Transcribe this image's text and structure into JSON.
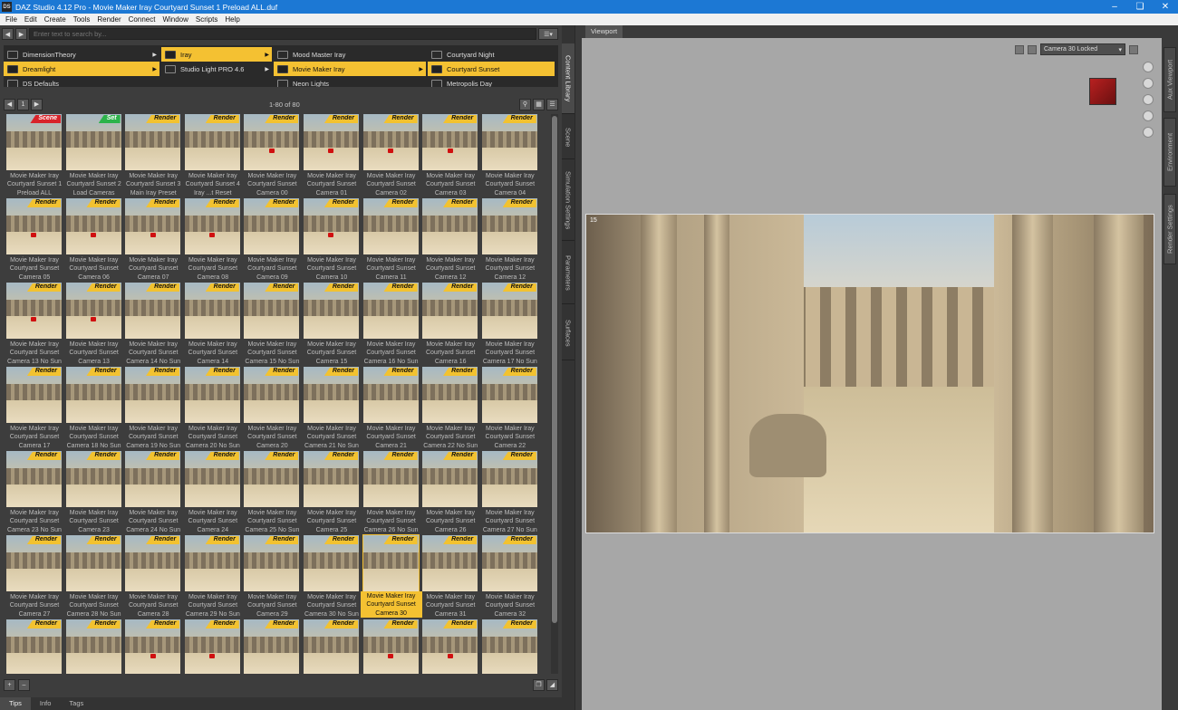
{
  "window": {
    "title": "DAZ Studio 4.12 Pro - Movie Maker Iray Courtyard Sunset 1 Preload ALL.duf",
    "logo": "DS"
  },
  "menu": [
    "File",
    "Edit",
    "Create",
    "Tools",
    "Render",
    "Connect",
    "Window",
    "Scripts",
    "Help"
  ],
  "search": {
    "placeholder": "Enter text to search by..."
  },
  "columns": [
    {
      "items": [
        {
          "label": "DimensionTheory",
          "selected": false,
          "arrow": "▶"
        },
        {
          "label": "Dreamlight",
          "selected": true,
          "arrow": "▶"
        },
        {
          "label": "DS Defaults",
          "selected": false,
          "arrow": ""
        }
      ]
    },
    {
      "items": [
        {
          "label": "Iray",
          "selected": true,
          "arrow": "▶"
        },
        {
          "label": "Studio Light PRO 4.6",
          "selected": false,
          "arrow": "▶"
        }
      ]
    },
    {
      "items": [
        {
          "label": "Mood Master Iray",
          "selected": false,
          "arrow": ""
        },
        {
          "label": "Movie Maker Iray",
          "selected": true,
          "arrow": "▶"
        },
        {
          "label": "Neon Lights",
          "selected": false,
          "arrow": ""
        }
      ]
    },
    {
      "items": [
        {
          "label": "Courtyard Night",
          "selected": false,
          "arrow": ""
        },
        {
          "label": "Courtyard Sunset",
          "selected": true,
          "arrow": ""
        },
        {
          "label": "Metropolis Day",
          "selected": false,
          "arrow": ""
        }
      ]
    }
  ],
  "pager": {
    "page": "1",
    "count": "1-80 of 80"
  },
  "items": [
    {
      "badge": "Scene",
      "kind": "scene",
      "caption": "Movie Maker Iray Courtyard Sunset 1 Preload ALL",
      "dot": false
    },
    {
      "badge": "Set",
      "kind": "set",
      "caption": "Movie Maker Iray Courtyard Sunset 2 Load Cameras",
      "dot": false
    },
    {
      "badge": "Render",
      "kind": "render",
      "caption": "Movie Maker Iray Courtyard Sunset 3 Main Iray Preset",
      "dot": false
    },
    {
      "badge": "Render",
      "kind": "render",
      "caption": "Movie Maker Iray Courtyard Sunset 4 Iray ...t Reset",
      "dot": false
    },
    {
      "badge": "Render",
      "kind": "render",
      "caption": "Movie Maker Iray Courtyard Sunset Camera 00",
      "dot": true
    },
    {
      "badge": "Render",
      "kind": "render",
      "caption": "Movie Maker Iray Courtyard Sunset Camera 01",
      "dot": true
    },
    {
      "badge": "Render",
      "kind": "render",
      "caption": "Movie Maker Iray Courtyard Sunset Camera 02",
      "dot": true
    },
    {
      "badge": "Render",
      "kind": "render",
      "caption": "Movie Maker Iray Courtyard Sunset Camera 03",
      "dot": true
    },
    {
      "badge": "Render",
      "kind": "render",
      "caption": "Movie Maker Iray Courtyard Sunset Camera 04",
      "dot": false
    },
    {
      "badge": "Render",
      "kind": "render",
      "caption": "Movie Maker Iray Courtyard Sunset Camera 05",
      "dot": true
    },
    {
      "badge": "Render",
      "kind": "render",
      "caption": "Movie Maker Iray Courtyard Sunset Camera 06",
      "dot": true
    },
    {
      "badge": "Render",
      "kind": "render",
      "caption": "Movie Maker Iray Courtyard Sunset Camera 07",
      "dot": true
    },
    {
      "badge": "Render",
      "kind": "render",
      "caption": "Movie Maker Iray Courtyard Sunset Camera 08",
      "dot": true
    },
    {
      "badge": "Render",
      "kind": "render",
      "caption": "Movie Maker Iray Courtyard Sunset Camera 09",
      "dot": false
    },
    {
      "badge": "Render",
      "kind": "render",
      "caption": "Movie Maker Iray Courtyard Sunset Camera 10",
      "dot": true
    },
    {
      "badge": "Render",
      "kind": "render",
      "caption": "Movie Maker Iray Courtyard Sunset Camera 11",
      "dot": false
    },
    {
      "badge": "Render",
      "kind": "render",
      "caption": "Movie Maker Iray Courtyard Sunset Camera 12",
      "dot": false
    },
    {
      "badge": "Render",
      "kind": "render",
      "caption": "Movie Maker Iray Courtyard Sunset Camera 12",
      "dot": false
    },
    {
      "badge": "Render",
      "kind": "render",
      "caption": "Movie Maker Iray Courtyard Sunset Camera 13 No Sun",
      "dot": true
    },
    {
      "badge": "Render",
      "kind": "render",
      "caption": "Movie Maker Iray Courtyard Sunset Camera 13",
      "dot": true
    },
    {
      "badge": "Render",
      "kind": "render",
      "caption": "Movie Maker Iray Courtyard Sunset Camera 14 No Sun",
      "dot": false
    },
    {
      "badge": "Render",
      "kind": "render",
      "caption": "Movie Maker Iray Courtyard Sunset Camera 14",
      "dot": false
    },
    {
      "badge": "Render",
      "kind": "render",
      "caption": "Movie Maker Iray Courtyard Sunset Camera 15 No Sun",
      "dot": false
    },
    {
      "badge": "Render",
      "kind": "render",
      "caption": "Movie Maker Iray Courtyard Sunset Camera 15",
      "dot": false
    },
    {
      "badge": "Render",
      "kind": "render",
      "caption": "Movie Maker Iray Courtyard Sunset Camera 16 No Sun",
      "dot": false
    },
    {
      "badge": "Render",
      "kind": "render",
      "caption": "Movie Maker Iray Courtyard Sunset Camera 16",
      "dot": false
    },
    {
      "badge": "Render",
      "kind": "render",
      "caption": "Movie Maker Iray Courtyard Sunset Camera 17 No Sun",
      "dot": false
    },
    {
      "badge": "Render",
      "kind": "render",
      "caption": "Movie Maker Iray Courtyard Sunset Camera 17",
      "dot": false
    },
    {
      "badge": "Render",
      "kind": "render",
      "caption": "Movie Maker Iray Courtyard Sunset Camera 18 No Sun",
      "dot": false
    },
    {
      "badge": "Render",
      "kind": "render",
      "caption": "Movie Maker Iray Courtyard Sunset Camera 19 No Sun",
      "dot": false
    },
    {
      "badge": "Render",
      "kind": "render",
      "caption": "Movie Maker Iray Courtyard Sunset Camera 20 No Sun",
      "dot": false
    },
    {
      "badge": "Render",
      "kind": "render",
      "caption": "Movie Maker Iray Courtyard Sunset Camera 20",
      "dot": false
    },
    {
      "badge": "Render",
      "kind": "render",
      "caption": "Movie Maker Iray Courtyard Sunset Camera 21 No Sun",
      "dot": false
    },
    {
      "badge": "Render",
      "kind": "render",
      "caption": "Movie Maker Iray Courtyard Sunset Camera 21",
      "dot": false
    },
    {
      "badge": "Render",
      "kind": "render",
      "caption": "Movie Maker Iray Courtyard Sunset Camera 22 No Sun",
      "dot": false
    },
    {
      "badge": "Render",
      "kind": "render",
      "caption": "Movie Maker Iray Courtyard Sunset Camera 22",
      "dot": false
    },
    {
      "badge": "Render",
      "kind": "render",
      "caption": "Movie Maker Iray Courtyard Sunset Camera 23 No Sun",
      "dot": false
    },
    {
      "badge": "Render",
      "kind": "render",
      "caption": "Movie Maker Iray Courtyard Sunset Camera 23",
      "dot": false
    },
    {
      "badge": "Render",
      "kind": "render",
      "caption": "Movie Maker Iray Courtyard Sunset Camera 24 No Sun",
      "dot": false
    },
    {
      "badge": "Render",
      "kind": "render",
      "caption": "Movie Maker Iray Courtyard Sunset Camera 24",
      "dot": false
    },
    {
      "badge": "Render",
      "kind": "render",
      "caption": "Movie Maker Iray Courtyard Sunset Camera 25 No Sun",
      "dot": false
    },
    {
      "badge": "Render",
      "kind": "render",
      "caption": "Movie Maker Iray Courtyard Sunset Camera 25",
      "dot": false
    },
    {
      "badge": "Render",
      "kind": "render",
      "caption": "Movie Maker Iray Courtyard Sunset Camera 26 No Sun",
      "dot": false
    },
    {
      "badge": "Render",
      "kind": "render",
      "caption": "Movie Maker Iray Courtyard Sunset Camera 26",
      "dot": false
    },
    {
      "badge": "Render",
      "kind": "render",
      "caption": "Movie Maker Iray Courtyard Sunset Camera 27 No Sun",
      "dot": false
    },
    {
      "badge": "Render",
      "kind": "render",
      "caption": "Movie Maker Iray Courtyard Sunset Camera 27",
      "dot": false
    },
    {
      "badge": "Render",
      "kind": "render",
      "caption": "Movie Maker Iray Courtyard Sunset Camera 28 No Sun",
      "dot": false
    },
    {
      "badge": "Render",
      "kind": "render",
      "caption": "Movie Maker Iray Courtyard Sunset Camera 28",
      "dot": false
    },
    {
      "badge": "Render",
      "kind": "render",
      "caption": "Movie Maker Iray Courtyard Sunset Camera 29 No Sun",
      "dot": false
    },
    {
      "badge": "Render",
      "kind": "render",
      "caption": "Movie Maker Iray Courtyard Sunset Camera 29",
      "dot": false
    },
    {
      "badge": "Render",
      "kind": "render",
      "caption": "Movie Maker Iray Courtyard Sunset Camera 30 No Sun",
      "dot": false
    },
    {
      "badge": "Render",
      "kind": "render",
      "caption": "Movie Maker Iray Courtyard Sunset Camera 30",
      "dot": false,
      "selected": true
    },
    {
      "badge": "Render",
      "kind": "render",
      "caption": "Movie Maker Iray Courtyard Sunset Camera 31",
      "dot": false
    },
    {
      "badge": "Render",
      "kind": "render",
      "caption": "Movie Maker Iray Courtyard Sunset Camera 32",
      "dot": false
    },
    {
      "badge": "Render",
      "kind": "render",
      "caption": "",
      "dot": false
    },
    {
      "badge": "Render",
      "kind": "render",
      "caption": "",
      "dot": false
    },
    {
      "badge": "Render",
      "kind": "render",
      "caption": "",
      "dot": true
    },
    {
      "badge": "Render",
      "kind": "render",
      "caption": "",
      "dot": true
    },
    {
      "badge": "Render",
      "kind": "render",
      "caption": "",
      "dot": false
    },
    {
      "badge": "Render",
      "kind": "render",
      "caption": "",
      "dot": false
    },
    {
      "badge": "Render",
      "kind": "render",
      "caption": "",
      "dot": true
    },
    {
      "badge": "Render",
      "kind": "render",
      "caption": "",
      "dot": true
    },
    {
      "badge": "Render",
      "kind": "render",
      "caption": "",
      "dot": false
    }
  ],
  "bottom_tabs": [
    "Tips",
    "Info",
    "Tags"
  ],
  "side_tabs": [
    "Content Library",
    "Scene",
    "Simulation Settings",
    "Parameters",
    "Surfaces"
  ],
  "viewport": {
    "tab": "Viewport",
    "camera": "Camera 30 Locked",
    "fps_label": "15"
  },
  "right_tabs": [
    "Aux Viewport",
    "Environment",
    "Render Settings"
  ],
  "colors": {
    "accent": "#f4c132",
    "titlebar": "#1c78d4"
  }
}
